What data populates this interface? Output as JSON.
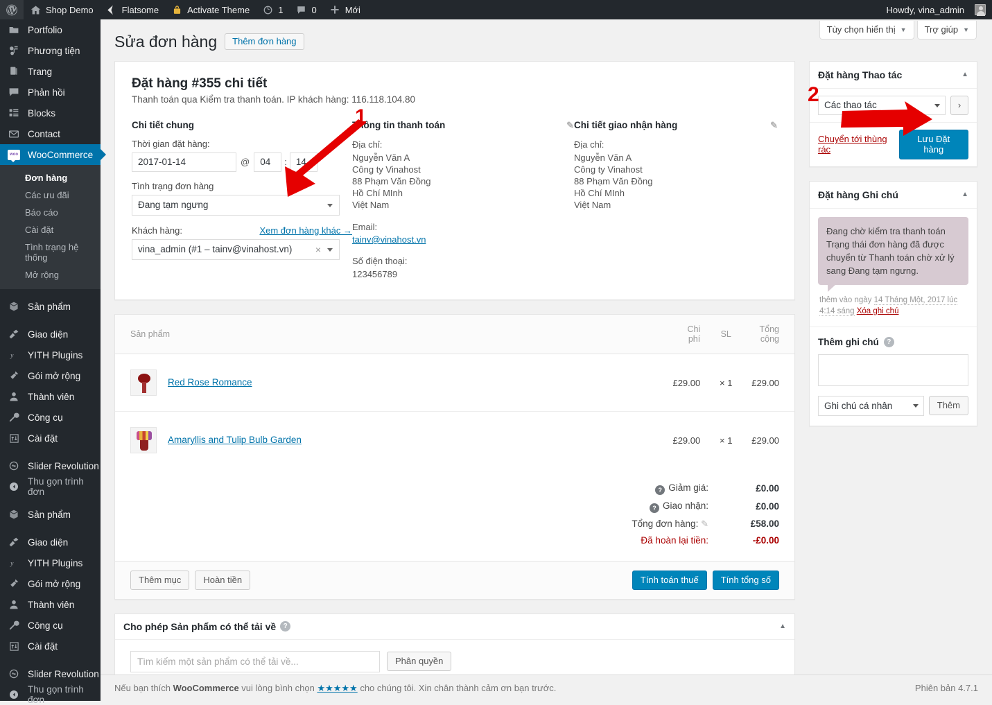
{
  "adminbar": {
    "items": [
      {
        "icon": "wordpress-logo-icon",
        "label": ""
      },
      {
        "icon": "home-icon",
        "label": "Shop Demo"
      },
      {
        "icon": "flatsome-icon",
        "label": "Flatsome"
      },
      {
        "icon": "lock-icon",
        "label": "Activate Theme"
      },
      {
        "icon": "updates-icon",
        "label": "1"
      },
      {
        "icon": "comment-icon",
        "label": "0"
      },
      {
        "icon": "plus-icon",
        "label": "Mới"
      }
    ],
    "howdy": "Howdy, vina_admin"
  },
  "sidebar": {
    "items": [
      {
        "label": "Portfolio",
        "icon": "portfolio-icon",
        "current": false
      },
      {
        "label": "Phương tiện",
        "icon": "media-icon",
        "current": false
      },
      {
        "label": "Trang",
        "icon": "pages-icon",
        "current": false
      },
      {
        "label": "Phản hồi",
        "icon": "comments-icon",
        "current": false
      },
      {
        "label": "Blocks",
        "icon": "blocks-icon",
        "current": false
      },
      {
        "label": "Contact",
        "icon": "mail-icon",
        "current": false
      },
      {
        "label": "WooCommerce",
        "icon": "woocommerce-icon",
        "current": true
      },
      {
        "label": "Sản phẩm",
        "icon": "product-icon",
        "current": false,
        "sep": true
      },
      {
        "label": "Giao diện",
        "icon": "appearance-icon",
        "current": false,
        "sep": true
      },
      {
        "label": "YITH Plugins",
        "icon": "yith-icon",
        "current": false
      },
      {
        "label": "Gói mở rộng",
        "icon": "plugin-icon",
        "current": false
      },
      {
        "label": "Thành viên",
        "icon": "users-icon",
        "current": false
      },
      {
        "label": "Công cụ",
        "icon": "tools-icon",
        "current": false
      },
      {
        "label": "Cài đặt",
        "icon": "settings-icon",
        "current": false
      },
      {
        "label": "Slider Revolution",
        "icon": "slider-icon",
        "current": false,
        "sep": true
      },
      {
        "label": "Thu gọn trình đơn",
        "icon": "collapse-icon",
        "current": false,
        "collapse": true
      },
      {
        "label": "Sản phẩm",
        "icon": "product-icon",
        "current": false,
        "sep": true
      },
      {
        "label": "Giao diện",
        "icon": "appearance-icon",
        "current": false,
        "sep": true
      },
      {
        "label": "YITH Plugins",
        "icon": "yith-icon",
        "current": false
      },
      {
        "label": "Gói mở rộng",
        "icon": "plugin-icon",
        "current": false
      },
      {
        "label": "Thành viên",
        "icon": "users-icon",
        "current": false
      },
      {
        "label": "Công cụ",
        "icon": "tools-icon",
        "current": false
      },
      {
        "label": "Cài đặt",
        "icon": "settings-icon",
        "current": false
      },
      {
        "label": "Slider Revolution",
        "icon": "slider-icon",
        "current": false,
        "sep": true
      },
      {
        "label": "Thu gọn trình đơn",
        "icon": "collapse-icon",
        "current": false,
        "collapse": true
      }
    ],
    "woo_submenu": [
      {
        "label": "Đơn hàng",
        "current": true
      },
      {
        "label": "Các ưu đãi",
        "current": false
      },
      {
        "label": "Báo cáo",
        "current": false
      },
      {
        "label": "Cài đặt",
        "current": false
      },
      {
        "label": "Tình trạng hệ thống",
        "current": false
      },
      {
        "label": "Mở rộng",
        "current": false
      }
    ]
  },
  "screen_meta": {
    "screen_options": "Tùy chọn hiển thị",
    "help": "Trợ giúp"
  },
  "page": {
    "title": "Sửa đơn hàng",
    "add_button": "Thêm đơn hàng"
  },
  "order": {
    "heading": "Đặt hàng #355 chi tiết",
    "subheading": "Thanh toán qua Kiểm tra thanh toán. IP khách hàng: 116.118.104.80",
    "general": {
      "title": "Chi tiết chung",
      "date_label": "Thời gian đặt hàng:",
      "date_value": "2017-01-14",
      "at": "@",
      "hour": "04",
      "colon": ":",
      "minute": "14",
      "status_label": "Tình trạng đơn hàng",
      "status_value": "Đang tạm ngưng",
      "customer_label": "Khách hàng:",
      "other_orders_link": "Xem đơn hàng khác →",
      "customer_value": "vina_admin (#1 – tainv@vinahost.vn)"
    },
    "billing": {
      "title": "Thông tin thanh toán",
      "address_label": "Địa chỉ:",
      "address_lines": [
        "Nguyễn Văn A",
        "Công ty Vinahost",
        "88 Phạm Văn Đồng",
        "Hồ Chí MInh",
        "Việt Nam"
      ],
      "email_label": "Email:",
      "email_value": "tainv@vinahost.vn",
      "phone_label": "Số điện thoại:",
      "phone_value": "123456789"
    },
    "shipping": {
      "title": "Chi tiết giao nhận hàng",
      "address_label": "Địa chỉ:",
      "address_lines": [
        "Nguyễn Văn A",
        "Công ty Vinahost",
        "88 Phạm Văn Đồng",
        "Hồ Chí MInh",
        "Việt Nam"
      ]
    }
  },
  "items": {
    "columns": {
      "product": "Sản phẩm",
      "cost_l1": "Chi",
      "cost_l2": "phí",
      "qty": "SL",
      "total_l1": "Tổng",
      "total_l2": "cộng"
    },
    "rows": [
      {
        "thumb": "rose",
        "name": "Red Rose Romance",
        "cost": "£29.00",
        "qty": "× 1",
        "total": "£29.00"
      },
      {
        "thumb": "tulip",
        "name": "Amaryllis and Tulip Bulb Garden",
        "cost": "£29.00",
        "qty": "× 1",
        "total": "£29.00"
      }
    ],
    "totals": [
      {
        "label": "Giảm giá:",
        "value": "£0.00",
        "help": true,
        "pencil": false,
        "refund": false
      },
      {
        "label": "Giao nhận:",
        "value": "£0.00",
        "help": true,
        "pencil": false,
        "refund": false
      },
      {
        "label": "Tổng đơn hàng:",
        "value": "£58.00",
        "help": false,
        "pencil": true,
        "refund": false
      },
      {
        "label": "Đã hoàn lại tiền:",
        "value": "-£0.00",
        "help": false,
        "pencil": false,
        "refund": true
      }
    ],
    "buttons": {
      "add_item": "Thêm mục",
      "refund": "Hoàn tiền",
      "calc_tax": "Tính toán thuế",
      "calc_total": "Tính tổng số"
    }
  },
  "downloadable": {
    "title": "Cho phép Sản phẩm có thể tải về",
    "search_placeholder": "Tìm kiếm một sản phẩm có thể tải về...",
    "grant_button": "Phân quyền"
  },
  "order_actions": {
    "title": "Đặt hàng Thao tác",
    "action_select": "Các thao tác",
    "go_button": "›",
    "trash_link": "Chuyển tới thùng rác",
    "save_button": "Lưu Đặt hàng"
  },
  "order_notes": {
    "title": "Đặt hàng Ghi chú",
    "notes": [
      {
        "text": "Đang chờ kiểm tra thanh toán Trạng thái đơn hàng đã được chuyển từ Thanh toán chờ xử lý sang Đang tạm ngưng.",
        "meta_prefix": "thêm vào ngày",
        "meta_date": "14 Tháng Một, 2017 lúc 4:14 sáng",
        "delete_label": "Xóa ghi chú"
      }
    ],
    "add_note_label": "Thêm ghi chú",
    "textarea_value": "",
    "note_type": "Ghi chú cá nhân",
    "add_button": "Thêm"
  },
  "footer": {
    "text_before": "Nếu bạn thích ",
    "brand": "WooCommerce",
    "text_mid": " vui lòng bình chọn ",
    "stars": "★★★★★",
    "text_after": " cho chúng tôi. Xin chân thành cảm ơn bạn trước.",
    "version": "Phiên bản 4.7.1"
  },
  "annotations": {
    "marker1": "1",
    "marker2": "2",
    "arrow_color": "#e50000"
  }
}
